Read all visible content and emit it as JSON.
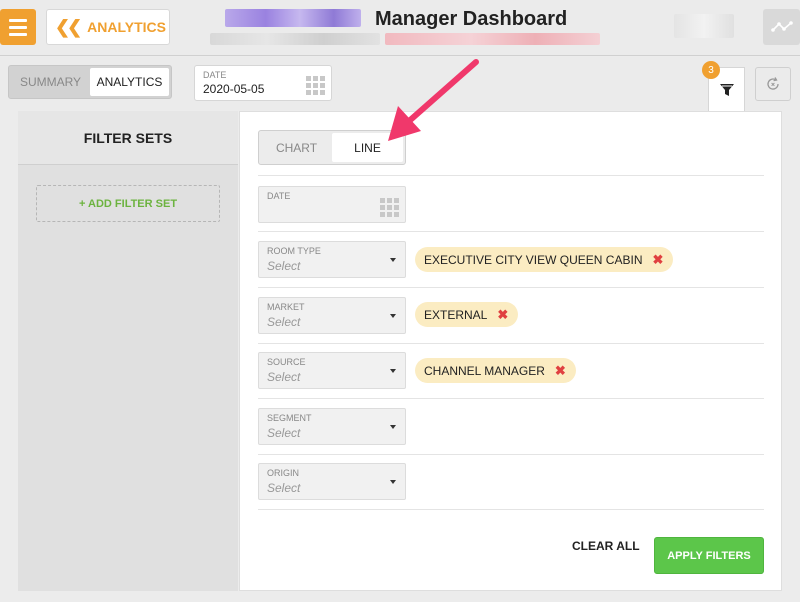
{
  "header": {
    "back_label": "ANALYTICS",
    "title": "Manager Dashboard"
  },
  "toolbar": {
    "tabs": [
      {
        "label": "SUMMARY",
        "active": false
      },
      {
        "label": "ANALYTICS",
        "active": true
      }
    ],
    "date_caption": "DATE",
    "date_value": "2020-05-05",
    "filter_badge": "3"
  },
  "filter_sets": {
    "title": "FILTER SETS",
    "add_label": "+ ADD FILTER SET"
  },
  "view_toggle": [
    {
      "label": "CHART",
      "active": false
    },
    {
      "label": "LINE",
      "active": true
    }
  ],
  "filters": {
    "date_caption": "DATE",
    "dropdowns": [
      {
        "caption": "ROOM TYPE",
        "placeholder": "Select",
        "chip": "EXECUTIVE CITY VIEW QUEEN CABIN"
      },
      {
        "caption": "MARKET",
        "placeholder": "Select",
        "chip": "EXTERNAL"
      },
      {
        "caption": "SOURCE",
        "placeholder": "Select",
        "chip": "CHANNEL MANAGER"
      },
      {
        "caption": "SEGMENT",
        "placeholder": "Select",
        "chip": null
      },
      {
        "caption": "ORIGIN",
        "placeholder": "Select",
        "chip": null
      }
    ],
    "remove_glyph": "✖"
  },
  "actions": {
    "clear_label": "CLEAR ALL",
    "apply_label": "APPLY FILTERS"
  },
  "colors": {
    "accent": "#f0a030",
    "apply_green": "#5cc64a",
    "annotation_arrow": "#f0386b",
    "chip_bg": "#fbecc2"
  },
  "icons": {
    "menu": "hamburger-icon",
    "back": "double-chevron-left-icon",
    "route": "route-icon",
    "calendar": "calendar-grid-icon",
    "filter": "funnel-icon",
    "refresh": "refresh-icon",
    "remove": "remove-x-icon",
    "dropdown": "caret-down-icon"
  }
}
